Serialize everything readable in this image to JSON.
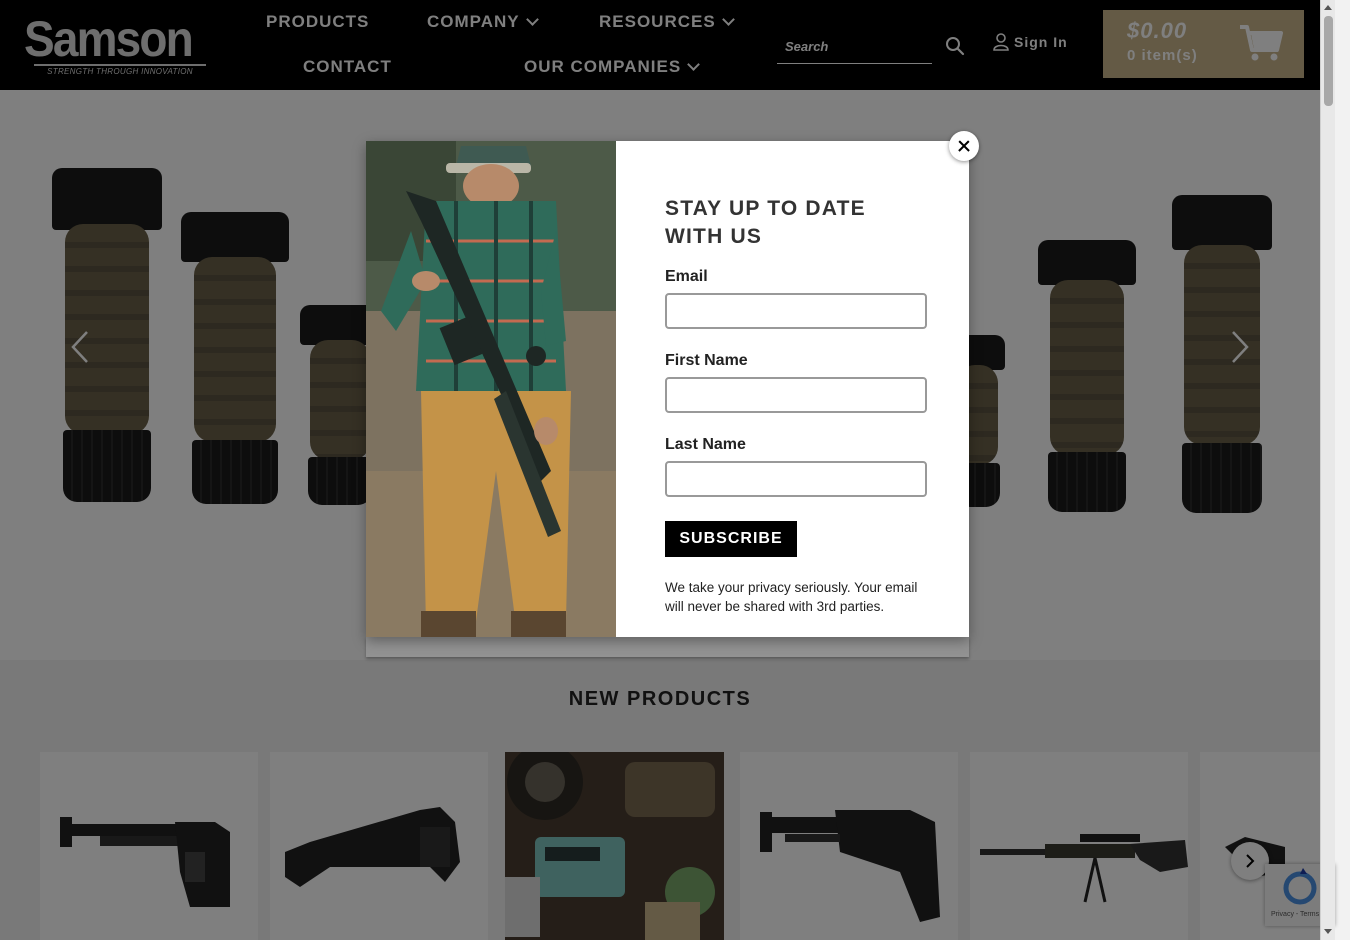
{
  "colors": {
    "header_bg": "#000000",
    "cart_bg": "#c8b48a",
    "grip_fde": "#6b6148",
    "overlay": "rgba(0,0,0,0.5)",
    "subscribe_bg": "#000000"
  },
  "logo": {
    "wordmark": "Samson",
    "tagline": "STRENGTH THROUGH INNOVATION"
  },
  "nav": {
    "items": [
      {
        "label": "PRODUCTS",
        "dropdown": false
      },
      {
        "label": "COMPANY",
        "dropdown": true
      },
      {
        "label": "RESOURCES",
        "dropdown": true
      },
      {
        "label": "CONTACT",
        "dropdown": false
      },
      {
        "label": "OUR COMPANIES",
        "dropdown": true
      }
    ]
  },
  "search": {
    "placeholder": "Search",
    "value": "",
    "icon": "search-icon"
  },
  "account": {
    "signin_label": "Sign In",
    "icon": "user-icon"
  },
  "cart": {
    "total": "$0.00",
    "items": "0 item(s)",
    "icon": "cart-icon"
  },
  "hero": {
    "prev_icon": "chevron-left-icon",
    "next_icon": "chevron-right-icon"
  },
  "new_products": {
    "title": "NEW PRODUCTS",
    "next_icon": "chevron-right-icon"
  },
  "popup": {
    "title": "STAY UP TO DATE WITH US",
    "fields": [
      {
        "label": "Email",
        "value": "",
        "placeholder": ""
      },
      {
        "label": "First Name",
        "value": "",
        "placeholder": ""
      },
      {
        "label": "Last Name",
        "value": "",
        "placeholder": ""
      }
    ],
    "subscribe_label": "SUBSCRIBE",
    "privacy_text": "We take your privacy seriously. Your email will never be shared with 3rd parties.",
    "close_icon": "close-icon"
  },
  "recaptcha": {
    "terms": "Privacy - Terms"
  }
}
